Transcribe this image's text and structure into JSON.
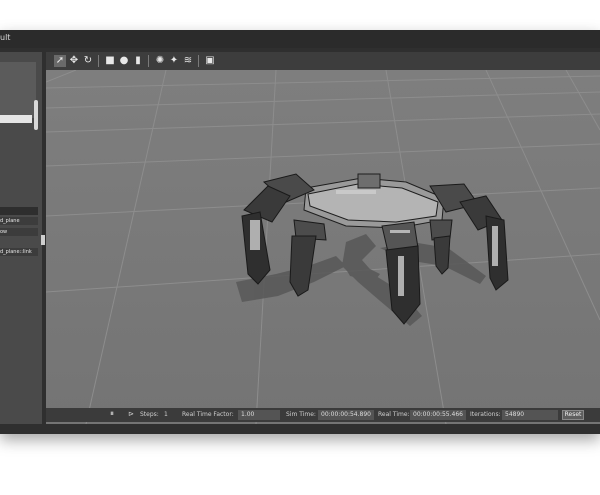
{
  "window": {
    "title": "ult"
  },
  "left_panel": {
    "rows": [
      "",
      "d_plane",
      "ow",
      "d_plane::link"
    ]
  },
  "toolbar": {
    "icons": [
      "select-arrow-icon",
      "translate-icon",
      "rotate-icon",
      "box-icon",
      "sphere-icon",
      "cylinder-icon",
      "point-light-icon",
      "spot-light-icon",
      "directional-light-icon",
      "camera-icon"
    ]
  },
  "status": {
    "pause_label": "⏸",
    "step_label": "⊳",
    "steps_label": "Steps:",
    "steps_value": "1",
    "rtf_label": "Real Time Factor:",
    "rtf_value": "1.00",
    "sim_time_label": "Sim Time:",
    "sim_time_value": "00:00:00:54.890",
    "real_time_label": "Real Time:",
    "real_time_value": "00:00:00:55.466",
    "iterations_label": "Iterations:",
    "iterations_value": "54890",
    "reset_label": "Reset"
  }
}
